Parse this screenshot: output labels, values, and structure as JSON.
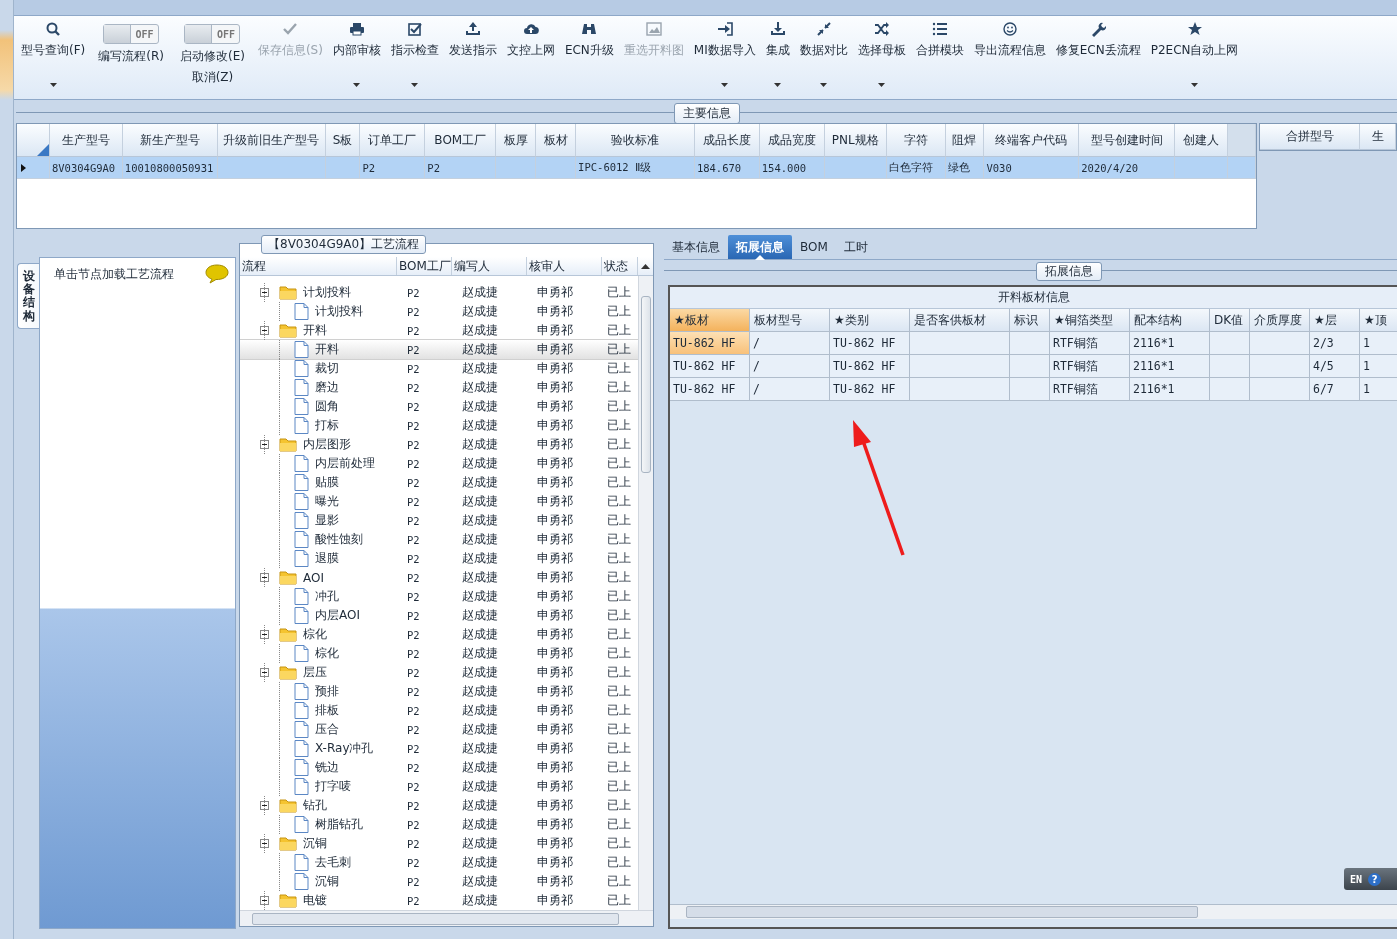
{
  "toolbar": {
    "items": [
      {
        "kind": "button",
        "label": "型号查询(F)",
        "disabled": false,
        "dropdown": true
      },
      {
        "kind": "toggle",
        "label": "编写流程(R)",
        "switch_text": "OFF",
        "on": false
      },
      {
        "kind": "toggle",
        "label": "启动修改(E)",
        "sublabel": "取消(Z)",
        "switch_text": "OFF",
        "on": false
      },
      {
        "kind": "button",
        "label": "保存信息(S)",
        "disabled": true,
        "dropdown": false
      },
      {
        "kind": "button",
        "label": "内部审核",
        "disabled": false,
        "dropdown": true
      },
      {
        "kind": "button",
        "label": "指示检查",
        "disabled": false,
        "dropdown": true
      },
      {
        "kind": "button",
        "label": "发送指示",
        "disabled": false,
        "dropdown": false
      },
      {
        "kind": "button",
        "label": "文控上网",
        "disabled": false,
        "dropdown": false
      },
      {
        "kind": "button",
        "label": "ECN升级",
        "disabled": false,
        "dropdown": false
      },
      {
        "kind": "button",
        "label": "重选开料图",
        "disabled": true,
        "dropdown": false
      },
      {
        "kind": "button",
        "label": "MI数据导入",
        "disabled": false,
        "dropdown": true
      },
      {
        "kind": "button",
        "label": "集成",
        "disabled": false,
        "dropdown": true
      },
      {
        "kind": "button",
        "label": "数据对比",
        "disabled": false,
        "dropdown": true
      },
      {
        "kind": "button",
        "label": "选择母板",
        "disabled": false,
        "dropdown": true
      },
      {
        "kind": "button",
        "label": "合拼模块",
        "disabled": false,
        "dropdown": false
      },
      {
        "kind": "button",
        "label": "导出流程信息",
        "disabled": false,
        "dropdown": false
      },
      {
        "kind": "button",
        "label": "修复ECN丢流程",
        "disabled": false,
        "dropdown": false
      },
      {
        "kind": "button",
        "label": "P2ECN自动上网",
        "disabled": false,
        "dropdown": true
      }
    ]
  },
  "main_info": {
    "title": "主要信息",
    "row_selected": true,
    "columns": [
      {
        "label": "生产型号",
        "value": "8V0304G9A0"
      },
      {
        "label": "新生产型号",
        "value": "10010800050931"
      },
      {
        "label": "升级前旧生产型号"
      },
      {
        "label": "S板"
      },
      {
        "label": "订单工厂",
        "value": "P2"
      },
      {
        "label": "BOM工厂",
        "value": "P2"
      },
      {
        "label": "板厚"
      },
      {
        "label": "板材"
      },
      {
        "label": "验收标准",
        "value": "IPC-6012 Ⅱ级"
      },
      {
        "label": "成品长度",
        "value": "184.670"
      },
      {
        "label": "成品宽度",
        "value": "154.000"
      },
      {
        "label": "PNL规格"
      },
      {
        "label": "字符",
        "value": "白色字符"
      },
      {
        "label": "阻焊",
        "value": "绿色"
      },
      {
        "label": "终端客户代码",
        "value": "V030"
      },
      {
        "label": "型号创建时间",
        "value": "2020/4/20"
      },
      {
        "label": "创建人"
      }
    ],
    "merge_columns": [
      "合拼型号",
      "生"
    ]
  },
  "sidebar": {
    "tab": {
      "label": "设备结构",
      "selected": true
    },
    "hint": "单击节点加载工艺流程"
  },
  "tree": {
    "title": "【8V0304G9A0】工艺流程",
    "columns": [
      "流程",
      "BOM工厂",
      "编写人",
      "核审人",
      "状态"
    ],
    "nodes": [
      {
        "kind": "folder",
        "label": "计划投料",
        "expanded": true,
        "selected": false,
        "bom": "P2",
        "writer": "赵成捷",
        "reviewer": "申勇祁",
        "status": "已上",
        "children": [
          {
            "kind": "document",
            "label": "计划投料",
            "selected": false,
            "bom": "P2",
            "writer": "赵成捷",
            "reviewer": "申勇祁",
            "status": "已上"
          }
        ]
      },
      {
        "kind": "folder",
        "label": "开料",
        "expanded": true,
        "selected": false,
        "bom": "P2",
        "writer": "赵成捷",
        "reviewer": "申勇祁",
        "status": "已上",
        "children": [
          {
            "kind": "document",
            "label": "开料",
            "selected": true,
            "bom": "P2",
            "writer": "赵成捷",
            "reviewer": "申勇祁",
            "status": "已上"
          },
          {
            "kind": "document",
            "label": "裁切",
            "selected": false,
            "bom": "P2",
            "writer": "赵成捷",
            "reviewer": "申勇祁",
            "status": "已上"
          },
          {
            "kind": "document",
            "label": "磨边",
            "selected": false,
            "bom": "P2",
            "writer": "赵成捷",
            "reviewer": "申勇祁",
            "status": "已上"
          },
          {
            "kind": "document",
            "label": "圆角",
            "selected": false,
            "bom": "P2",
            "writer": "赵成捷",
            "reviewer": "申勇祁",
            "status": "已上"
          },
          {
            "kind": "document",
            "label": "打标",
            "selected": false,
            "bom": "P2",
            "writer": "赵成捷",
            "reviewer": "申勇祁",
            "status": "已上"
          }
        ]
      },
      {
        "kind": "folder",
        "label": "内层图形",
        "expanded": true,
        "selected": false,
        "bom": "P2",
        "writer": "赵成捷",
        "reviewer": "申勇祁",
        "status": "已上",
        "children": [
          {
            "kind": "document",
            "label": "内层前处理",
            "selected": false,
            "bom": "P2",
            "writer": "赵成捷",
            "reviewer": "申勇祁",
            "status": "已上"
          },
          {
            "kind": "document",
            "label": "贴膜",
            "selected": false,
            "bom": "P2",
            "writer": "赵成捷",
            "reviewer": "申勇祁",
            "status": "已上"
          },
          {
            "kind": "document",
            "label": "曝光",
            "selected": false,
            "bom": "P2",
            "writer": "赵成捷",
            "reviewer": "申勇祁",
            "status": "已上"
          },
          {
            "kind": "document",
            "label": "显影",
            "selected": false,
            "bom": "P2",
            "writer": "赵成捷",
            "reviewer": "申勇祁",
            "status": "已上"
          },
          {
            "kind": "document",
            "label": "酸性蚀刻",
            "selected": false,
            "bom": "P2",
            "writer": "赵成捷",
            "reviewer": "申勇祁",
            "status": "已上"
          },
          {
            "kind": "document",
            "label": "退膜",
            "selected": false,
            "bom": "P2",
            "writer": "赵成捷",
            "reviewer": "申勇祁",
            "status": "已上"
          }
        ]
      },
      {
        "kind": "folder",
        "label": "AOI",
        "expanded": true,
        "selected": false,
        "bom": "P2",
        "writer": "赵成捷",
        "reviewer": "申勇祁",
        "status": "已上",
        "children": [
          {
            "kind": "document",
            "label": "冲孔",
            "selected": false,
            "bom": "P2",
            "writer": "赵成捷",
            "reviewer": "申勇祁",
            "status": "已上"
          },
          {
            "kind": "document",
            "label": "内层AOI",
            "selected": false,
            "bom": "P2",
            "writer": "赵成捷",
            "reviewer": "申勇祁",
            "status": "已上"
          }
        ]
      },
      {
        "kind": "folder",
        "label": "棕化",
        "expanded": true,
        "selected": false,
        "bom": "P2",
        "writer": "赵成捷",
        "reviewer": "申勇祁",
        "status": "已上",
        "children": [
          {
            "kind": "document",
            "label": "棕化",
            "selected": false,
            "bom": "P2",
            "writer": "赵成捷",
            "reviewer": "申勇祁",
            "status": "已上"
          }
        ]
      },
      {
        "kind": "folder",
        "label": "层压",
        "expanded": true,
        "selected": false,
        "bom": "P2",
        "writer": "赵成捷",
        "reviewer": "申勇祁",
        "status": "已上",
        "children": [
          {
            "kind": "document",
            "label": "预排",
            "selected": false,
            "bom": "P2",
            "writer": "赵成捷",
            "reviewer": "申勇祁",
            "status": "已上"
          },
          {
            "kind": "document",
            "label": "排板",
            "selected": false,
            "bom": "P2",
            "writer": "赵成捷",
            "reviewer": "申勇祁",
            "status": "已上"
          },
          {
            "kind": "document",
            "label": "压合",
            "selected": false,
            "bom": "P2",
            "writer": "赵成捷",
            "reviewer": "申勇祁",
            "status": "已上"
          },
          {
            "kind": "document",
            "label": "X-Ray冲孔",
            "selected": false,
            "bom": "P2",
            "writer": "赵成捷",
            "reviewer": "申勇祁",
            "status": "已上"
          },
          {
            "kind": "document",
            "label": "铣边",
            "selected": false,
            "bom": "P2",
            "writer": "赵成捷",
            "reviewer": "申勇祁",
            "status": "已上"
          },
          {
            "kind": "document",
            "label": "打字唛",
            "selected": false,
            "bom": "P2",
            "writer": "赵成捷",
            "reviewer": "申勇祁",
            "status": "已上"
          }
        ]
      },
      {
        "kind": "folder",
        "label": "钻孔",
        "expanded": true,
        "selected": false,
        "bom": "P2",
        "writer": "赵成捷",
        "reviewer": "申勇祁",
        "status": "已上",
        "children": [
          {
            "kind": "document",
            "label": "树脂钻孔",
            "selected": false,
            "bom": "P2",
            "writer": "赵成捷",
            "reviewer": "申勇祁",
            "status": "已上"
          }
        ]
      },
      {
        "kind": "folder",
        "label": "沉铜",
        "expanded": true,
        "selected": false,
        "bom": "P2",
        "writer": "赵成捷",
        "reviewer": "申勇祁",
        "status": "已上",
        "children": [
          {
            "kind": "document",
            "label": "去毛刺",
            "selected": false,
            "bom": "P2",
            "writer": "赵成捷",
            "reviewer": "申勇祁",
            "status": "已上"
          },
          {
            "kind": "document",
            "label": "沉铜",
            "selected": false,
            "bom": "P2",
            "writer": "赵成捷",
            "reviewer": "申勇祁",
            "status": "已上"
          }
        ]
      },
      {
        "kind": "folder",
        "label": "电镀",
        "expanded": true,
        "selected": false,
        "bom": "P2",
        "writer": "赵成捷",
        "reviewer": "申勇祁",
        "status": "已上"
      }
    ]
  },
  "detail_tabs": [
    {
      "label": "基本信息",
      "selected": false
    },
    {
      "label": "拓展信息",
      "selected": true
    },
    {
      "label": "BOM",
      "selected": false
    },
    {
      "label": "工时",
      "selected": false
    }
  ],
  "extension": {
    "title": "拓展信息",
    "caption": "开料板材信息",
    "columns": [
      {
        "label": "★板材",
        "selected": true
      },
      {
        "label": "板材型号",
        "selected": false
      },
      {
        "label": "★类别",
        "selected": false
      },
      {
        "label": "是否客供板材",
        "selected": false
      },
      {
        "label": "标识",
        "selected": false
      },
      {
        "label": "★铜箔类型",
        "selected": false
      },
      {
        "label": "配本结构",
        "selected": false
      },
      {
        "label": "DK值",
        "selected": false
      },
      {
        "label": "介质厚度",
        "selected": false
      },
      {
        "label": "★层",
        "selected": false
      },
      {
        "label": "★顶",
        "selected": false
      }
    ],
    "rows": [
      {
        "cells": [
          {
            "text": "TU-862 HF",
            "selected": true
          },
          {
            "text": "/",
            "selected": false
          },
          {
            "text": "TU-862 HF",
            "selected": false
          },
          {
            "selected": false
          },
          {
            "selected": false
          },
          {
            "text": "RTF铜箔",
            "selected": false
          },
          {
            "text": "2116*1",
            "selected": false
          },
          {
            "selected": false
          },
          {
            "selected": false
          },
          {
            "text": "2/3",
            "selected": false
          },
          {
            "text": "1",
            "selected": false
          }
        ]
      },
      {
        "cells": [
          {
            "text": "TU-862 HF",
            "selected": false
          },
          {
            "text": "/",
            "selected": false
          },
          {
            "text": "TU-862 HF",
            "selected": false
          },
          {
            "selected": false
          },
          {
            "selected": false
          },
          {
            "text": "RTF铜箔",
            "selected": false
          },
          {
            "text": "2116*1",
            "selected": false
          },
          {
            "selected": false
          },
          {
            "selected": false
          },
          {
            "text": "4/5",
            "selected": false
          },
          {
            "text": "1",
            "selected": false
          }
        ]
      },
      {
        "cells": [
          {
            "text": "TU-862 HF",
            "selected": false
          },
          {
            "text": "/",
            "selected": false
          },
          {
            "text": "TU-862 HF",
            "selected": false
          },
          {
            "selected": false
          },
          {
            "selected": false
          },
          {
            "text": "RTF铜箔",
            "selected": false
          },
          {
            "text": "2116*1",
            "selected": false
          },
          {
            "selected": false
          },
          {
            "selected": false
          },
          {
            "text": "6/7",
            "selected": false
          },
          {
            "text": "1",
            "selected": false
          }
        ]
      }
    ]
  },
  "language_bar": {
    "language": "EN",
    "help": "?"
  }
}
